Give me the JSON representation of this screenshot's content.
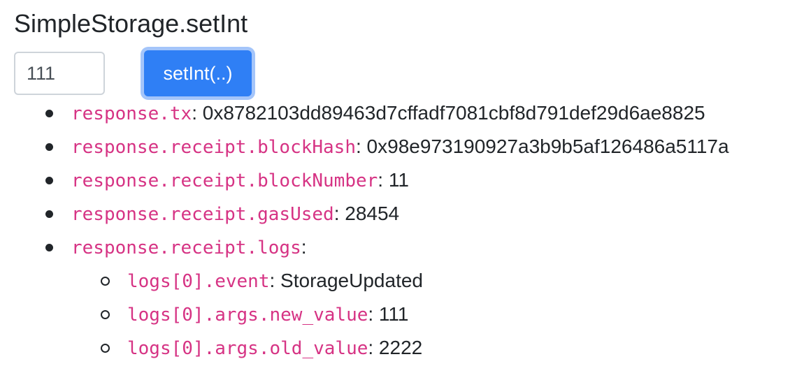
{
  "title": "SimpleStorage.setInt",
  "form": {
    "input_value": "111",
    "button_label": "setInt(..)"
  },
  "results": {
    "tx": {
      "key": "response.tx",
      "value": ": 0x8782103dd89463d7cffadf7081cbf8d791def29d6ae8825"
    },
    "block_hash": {
      "key": "response.receipt.blockHash",
      "value": ": 0x98e973190927a3b9b5af126486a5117a"
    },
    "block_number": {
      "key": "response.receipt.blockNumber",
      "value": ": 11"
    },
    "gas_used": {
      "key": "response.receipt.gasUsed",
      "value": ": 28454"
    },
    "logs": {
      "key": "response.receipt.logs",
      "value": ":",
      "items": {
        "event": {
          "key": "logs[0].event",
          "value": ": StorageUpdated"
        },
        "new_value": {
          "key": "logs[0].args.new_value",
          "value": ": 111"
        },
        "old_value": {
          "key": "logs[0].args.old_value",
          "value": ": 2222"
        }
      }
    }
  },
  "colors": {
    "code": "#d63384",
    "button": "#2f7ff5",
    "text": "#212529"
  }
}
